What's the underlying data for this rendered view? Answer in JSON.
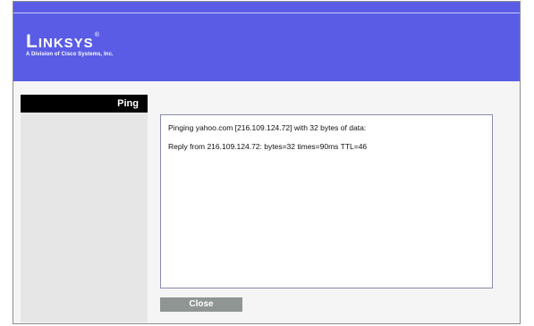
{
  "brand": {
    "name": "Linksys",
    "registered_mark": "®",
    "tagline": "A Division of Cisco Systems, Inc."
  },
  "sidebar": {
    "section_label": "Ping"
  },
  "output": {
    "lines": [
      "Pinging yahoo.com [216.109.124.72] with 32 bytes of data:",
      "Reply from 216.109.124.72: bytes=32 times=90ms TTL=46"
    ]
  },
  "actions": {
    "close_label": "Close"
  },
  "colors": {
    "header_blue": "#5a5ce6",
    "sidebar_bar": "#000000",
    "sidebar_bg": "#e6e6e6",
    "button_gray": "#8f9593"
  }
}
